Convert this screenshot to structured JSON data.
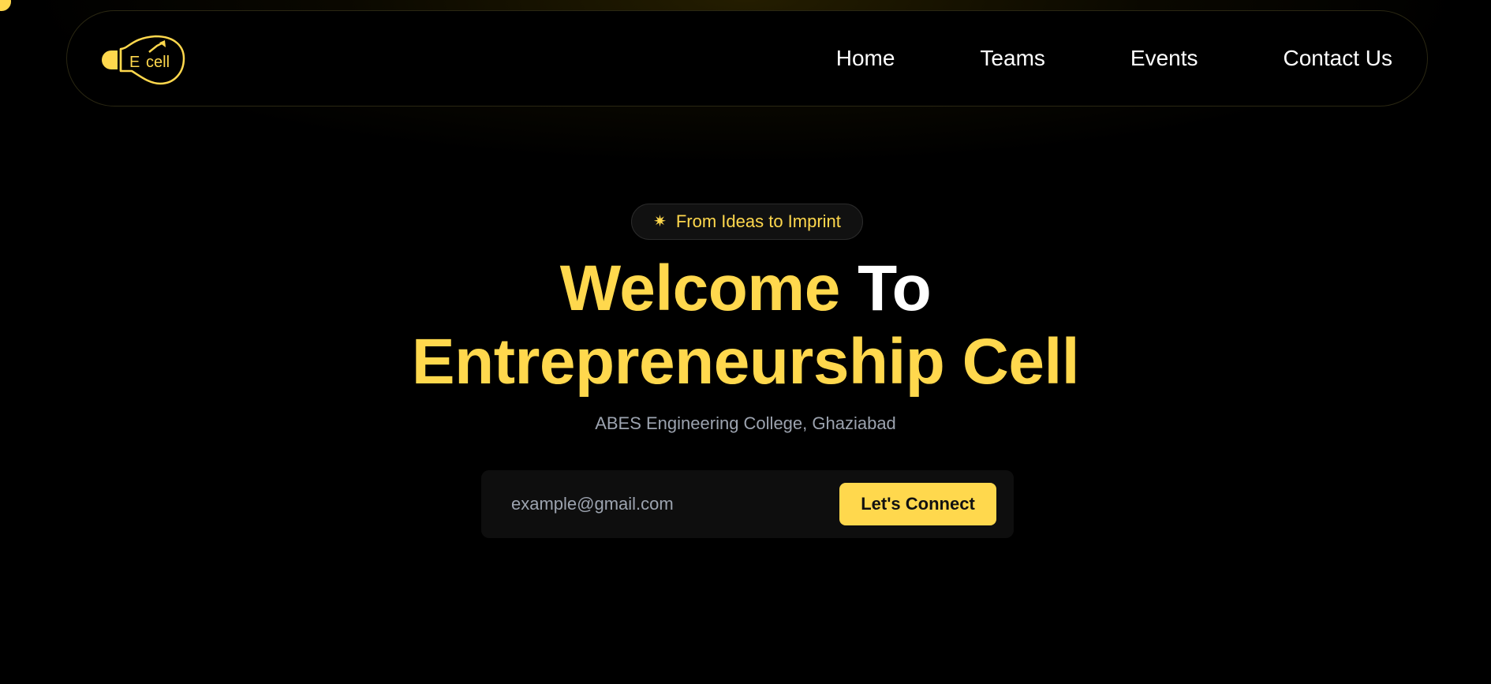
{
  "colors": {
    "accent": "#ffd84d",
    "background": "#000000",
    "text_primary": "#ffffff",
    "text_muted": "#9ca3af",
    "input_panel": "#0e0e0e"
  },
  "logo": {
    "text_e": "E",
    "text_cell": "cell",
    "icon": "lightbulb-icon"
  },
  "nav": {
    "items": [
      {
        "label": "Home"
      },
      {
        "label": "Teams"
      },
      {
        "label": "Events"
      },
      {
        "label": "Contact Us"
      }
    ]
  },
  "hero": {
    "badge": {
      "icon": "sparkle-icon",
      "text": "From Ideas to Imprint"
    },
    "title_line1_accent": "Welcome",
    "title_line1_plain": "To",
    "title_line2": "Entrepreneurship Cell",
    "subtitle": "ABES Engineering College, Ghaziabad"
  },
  "connect": {
    "email_placeholder": "example@gmail.com",
    "email_value": "",
    "button_label": "Let's Connect"
  }
}
